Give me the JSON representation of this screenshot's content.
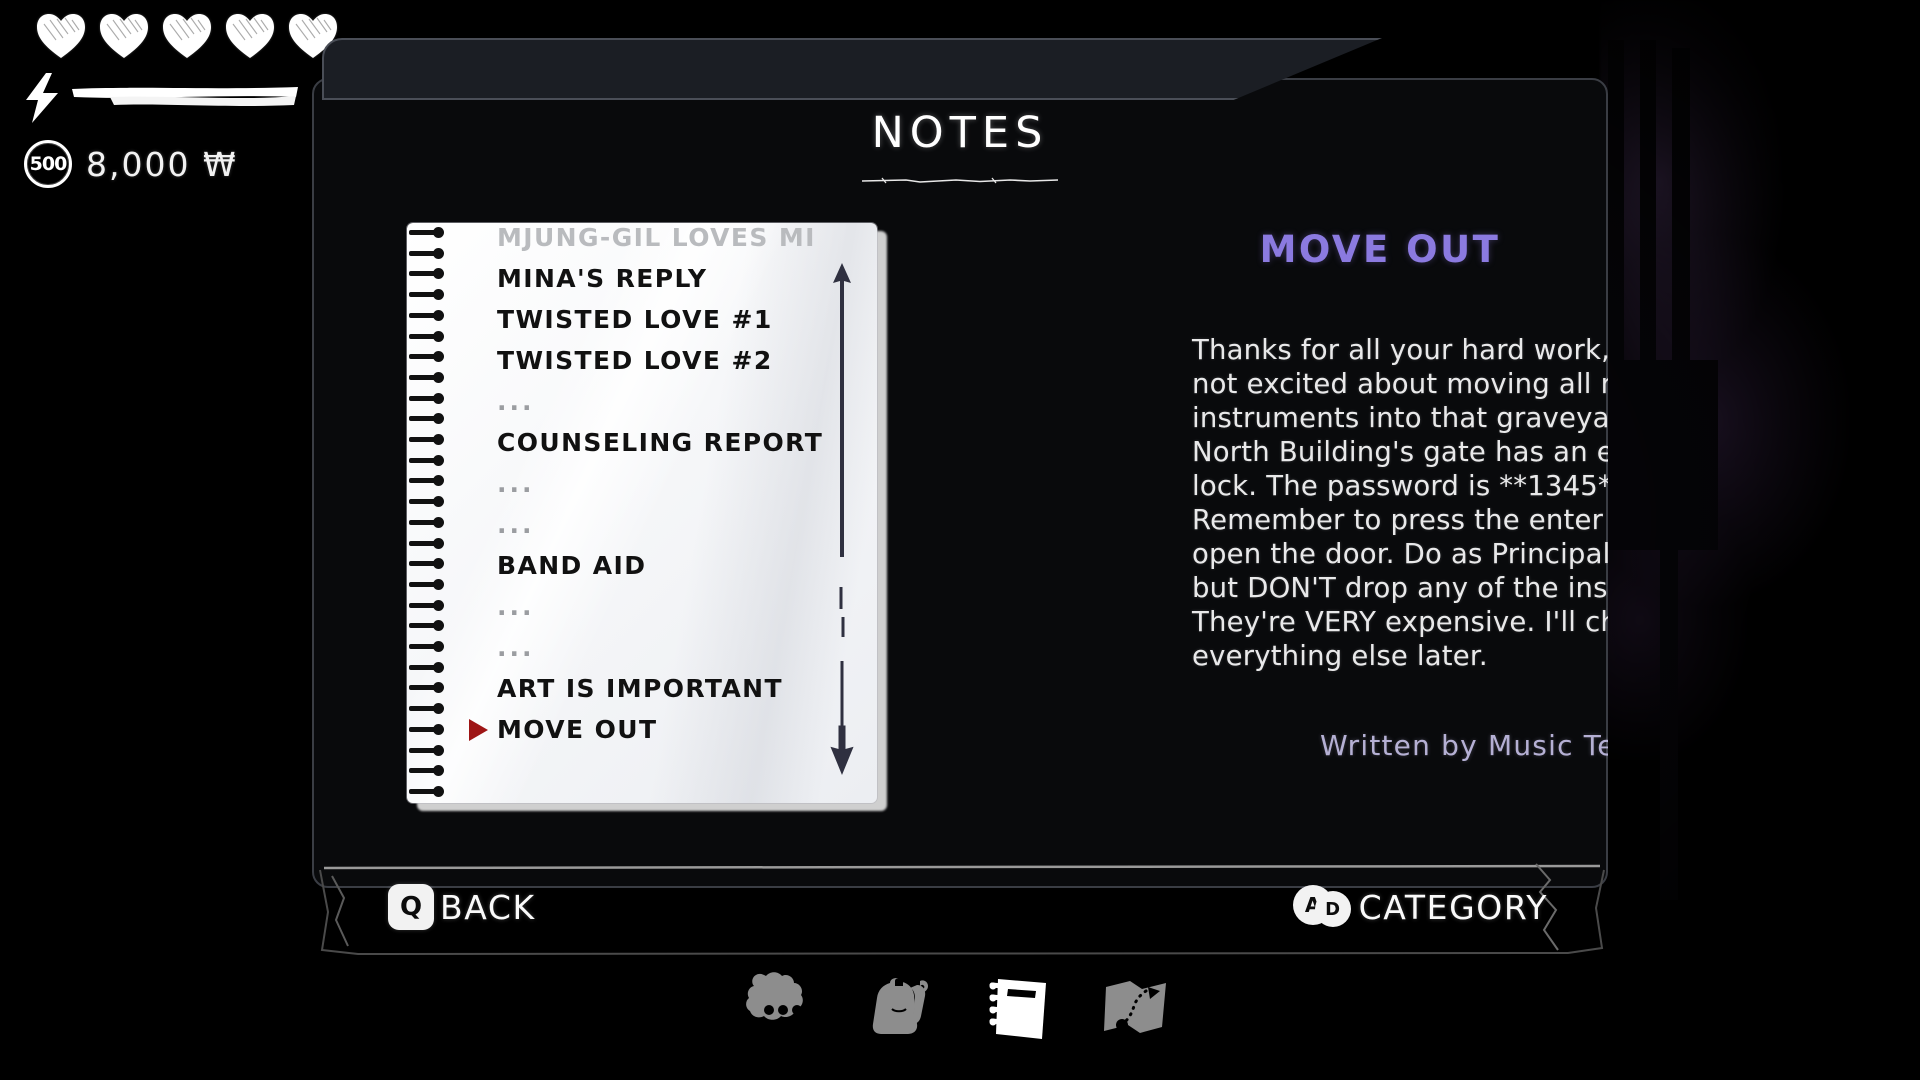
{
  "hud": {
    "hearts": 5,
    "heart_icon": "heart-icon",
    "stamina_icon": "lightning-bolt-icon",
    "stamina_full": true,
    "coin_icon_label": "500",
    "money": "8,000 ₩"
  },
  "panel": {
    "title": "NOTES"
  },
  "notebook": {
    "items": [
      {
        "label": "MJUNG-GIL LOVES MI",
        "type": "clipped",
        "selected": false
      },
      {
        "label": "MINA'S REPLY",
        "type": "entry",
        "selected": false
      },
      {
        "label": "TWISTED LOVE #1",
        "type": "entry",
        "selected": false
      },
      {
        "label": "TWISTED LOVE #2",
        "type": "entry",
        "selected": false
      },
      {
        "label": "...",
        "type": "locked",
        "selected": false
      },
      {
        "label": "COUNSELING REPORT",
        "type": "entry",
        "selected": false
      },
      {
        "label": "...",
        "type": "locked",
        "selected": false
      },
      {
        "label": "...",
        "type": "locked",
        "selected": false
      },
      {
        "label": "BAND AID",
        "type": "entry",
        "selected": false
      },
      {
        "label": "...",
        "type": "locked",
        "selected": false
      },
      {
        "label": "...",
        "type": "locked",
        "selected": false
      },
      {
        "label": "ART IS IMPORTANT",
        "type": "entry",
        "selected": false
      },
      {
        "label": "MOVE OUT",
        "type": "entry",
        "selected": true
      }
    ],
    "scroll_up_icon": "scroll-up-arrow-icon",
    "scroll_down_icon": "scroll-down-arrow-icon",
    "selection_marker_icon": "selection-triangle-icon",
    "selection_marker_color": "#9e1515"
  },
  "pagination": {
    "total": 5,
    "active_index": 3
  },
  "note": {
    "title": "MOVE OUT",
    "title_color": "#8b7ae0",
    "body": "Thanks for all your hard work, though I'm not excited about moving all my instruments into that graveyard. The North Building's gate has an electronic lock. The password is **1345**. Remember to press the enter button to open the door. Do as Principal Lee says, but DON'T drop any of the instruments! They're VERY expensive. I'll check on everything else later.",
    "author": "Written by Music Teacher Noh",
    "author_color": "#b5b0d4"
  },
  "footer": {
    "back": {
      "key": "Q",
      "label": "BACK",
      "key_icon": "key-q-icon"
    },
    "category": {
      "key_a": "A",
      "key_d": "D",
      "label": "CATEGORY",
      "key_icon": "key-ad-icon"
    }
  },
  "category_tabs": [
    {
      "icon": "dialogue-bubble-icon",
      "active": false
    },
    {
      "icon": "backpack-icon",
      "active": false
    },
    {
      "icon": "notebook-icon",
      "active": true
    },
    {
      "icon": "map-icon",
      "active": false
    }
  ]
}
